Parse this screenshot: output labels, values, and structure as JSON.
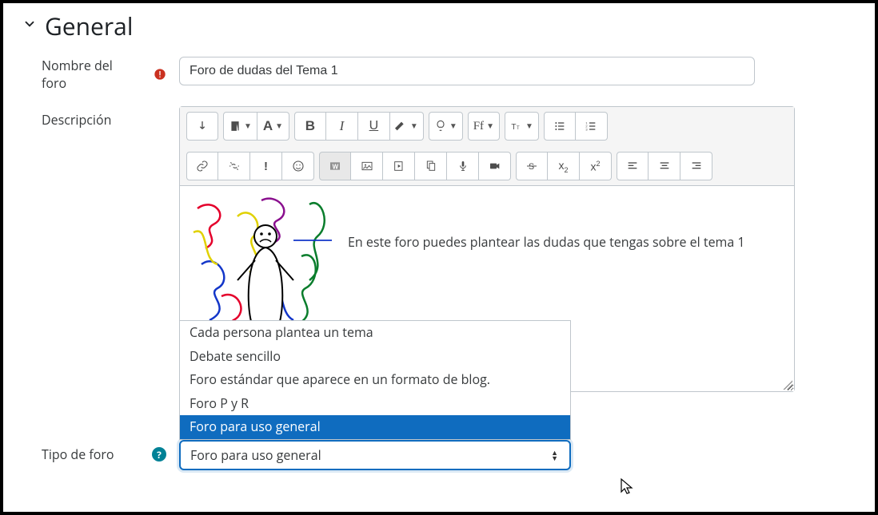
{
  "section": {
    "title": "General"
  },
  "fields": {
    "name": {
      "label": "Nombre del foro",
      "value": "Foro de dudas del Tema 1"
    },
    "description": {
      "label": "Descripción",
      "body_text": "En este foro puedes plantear las dudas que tengas sobre el tema 1"
    },
    "forum_type": {
      "label": "Tipo de foro",
      "selected": "Foro para uso general",
      "options": [
        "Cada persona plantea un tema",
        "Debate sencillo",
        "Foro estándar que aparece en un formato de blog.",
        "Foro P y R",
        "Foro para uso general"
      ],
      "highlighted_index": 4
    }
  },
  "toolbar_labels": {
    "font_family_abbrev": "Ff"
  }
}
